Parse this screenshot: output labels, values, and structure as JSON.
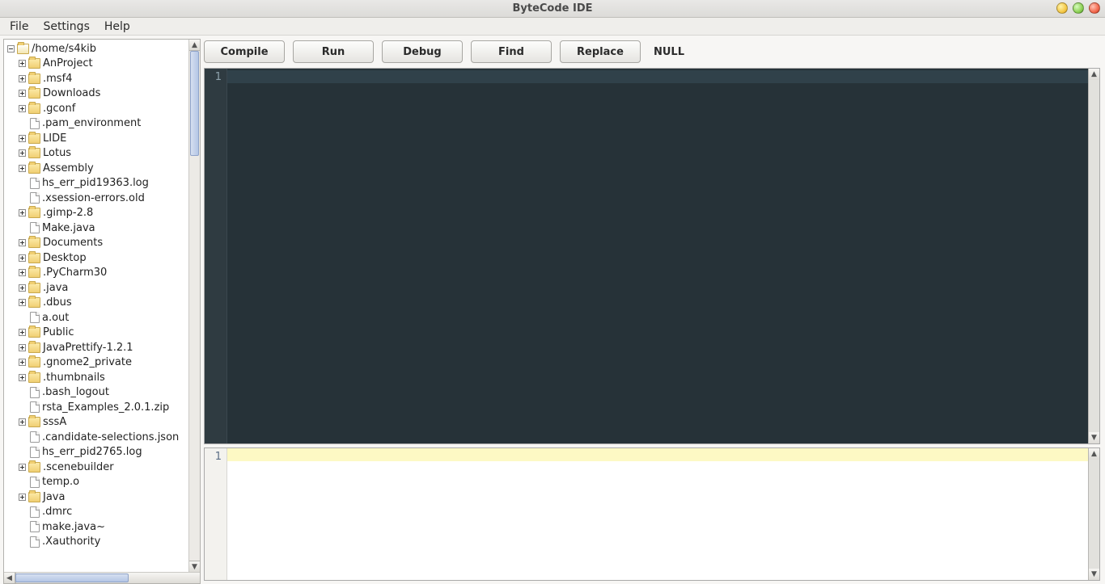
{
  "window": {
    "title": "ByteCode IDE"
  },
  "menu": {
    "items": [
      "File",
      "Settings",
      "Help"
    ]
  },
  "toolbar": {
    "buttons": [
      "Compile",
      "Run",
      "Debug",
      "Find",
      "Replace"
    ],
    "status": "NULL"
  },
  "editor": {
    "gutter_first": "1"
  },
  "console": {
    "gutter_first": "1"
  },
  "tree": {
    "root": {
      "label": "/home/s4kib",
      "icon": "folder-open",
      "expandable": true,
      "expanded": true
    },
    "children": [
      {
        "label": "AnProject",
        "icon": "folder",
        "expandable": true
      },
      {
        "label": ".msf4",
        "icon": "folder",
        "expandable": true
      },
      {
        "label": "Downloads",
        "icon": "folder",
        "expandable": true
      },
      {
        "label": ".gconf",
        "icon": "folder",
        "expandable": true
      },
      {
        "label": ".pam_environment",
        "icon": "file",
        "expandable": false
      },
      {
        "label": "LIDE",
        "icon": "folder",
        "expandable": true
      },
      {
        "label": "Lotus",
        "icon": "folder",
        "expandable": true
      },
      {
        "label": "Assembly",
        "icon": "folder",
        "expandable": true
      },
      {
        "label": "hs_err_pid19363.log",
        "icon": "file",
        "expandable": false
      },
      {
        "label": ".xsession-errors.old",
        "icon": "file",
        "expandable": false
      },
      {
        "label": ".gimp-2.8",
        "icon": "folder",
        "expandable": true
      },
      {
        "label": "Make.java",
        "icon": "file",
        "expandable": false
      },
      {
        "label": "Documents",
        "icon": "folder",
        "expandable": true
      },
      {
        "label": "Desktop",
        "icon": "folder",
        "expandable": true
      },
      {
        "label": ".PyCharm30",
        "icon": "folder",
        "expandable": true
      },
      {
        "label": ".java",
        "icon": "folder",
        "expandable": true
      },
      {
        "label": ".dbus",
        "icon": "folder",
        "expandable": true
      },
      {
        "label": "a.out",
        "icon": "file",
        "expandable": false
      },
      {
        "label": "Public",
        "icon": "folder",
        "expandable": true
      },
      {
        "label": "JavaPrettify-1.2.1",
        "icon": "folder",
        "expandable": true
      },
      {
        "label": ".gnome2_private",
        "icon": "folder",
        "expandable": true
      },
      {
        "label": ".thumbnails",
        "icon": "folder",
        "expandable": true
      },
      {
        "label": ".bash_logout",
        "icon": "file",
        "expandable": false
      },
      {
        "label": "rsta_Examples_2.0.1.zip",
        "icon": "file",
        "expandable": false
      },
      {
        "label": "sssA",
        "icon": "folder",
        "expandable": true
      },
      {
        "label": ".candidate-selections.json",
        "icon": "file",
        "expandable": false
      },
      {
        "label": "hs_err_pid2765.log",
        "icon": "file",
        "expandable": false
      },
      {
        "label": ".scenebuilder",
        "icon": "folder",
        "expandable": true
      },
      {
        "label": "temp.o",
        "icon": "file",
        "expandable": false
      },
      {
        "label": "Java",
        "icon": "folder",
        "expandable": true
      },
      {
        "label": ".dmrc",
        "icon": "file",
        "expandable": false
      },
      {
        "label": "make.java~",
        "icon": "file",
        "expandable": false
      },
      {
        "label": ".Xauthority",
        "icon": "file",
        "expandable": false
      }
    ]
  }
}
